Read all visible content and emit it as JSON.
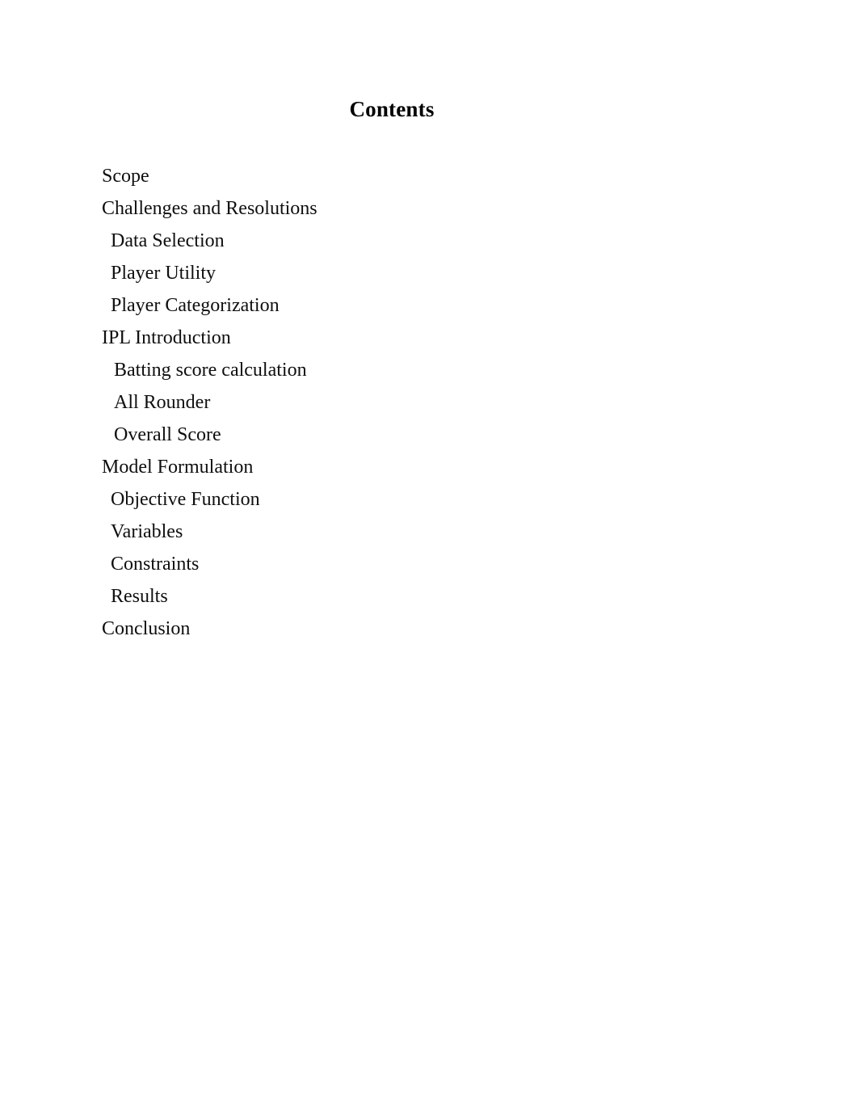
{
  "document": {
    "heading": "Contents",
    "background_color": "#ffffff",
    "text_color": "#100f0f"
  },
  "toc": {
    "entries": [
      {
        "label": "Scope",
        "level": 1
      },
      {
        "label": "Challenges and Resolutions",
        "level": 1
      },
      {
        "label": "Data Selection",
        "level": 2
      },
      {
        "label": "Player Utility",
        "level": 2
      },
      {
        "label": "Player Categorization",
        "level": 2
      },
      {
        "label": "IPL Introduction",
        "level": 1
      },
      {
        "label": "Batting score calculation",
        "level": 2
      },
      {
        "label": "All Rounder",
        "level": 2
      },
      {
        "label": "Overall Score",
        "level": 2
      },
      {
        "label": "Model Formulation",
        "level": 1
      },
      {
        "label": "Objective Function",
        "level": 2
      },
      {
        "label": "Variables",
        "level": 2
      },
      {
        "label": "Constraints",
        "level": 2
      },
      {
        "label": "Results",
        "level": 2
      },
      {
        "label": "Conclusion",
        "level": 1
      }
    ]
  }
}
